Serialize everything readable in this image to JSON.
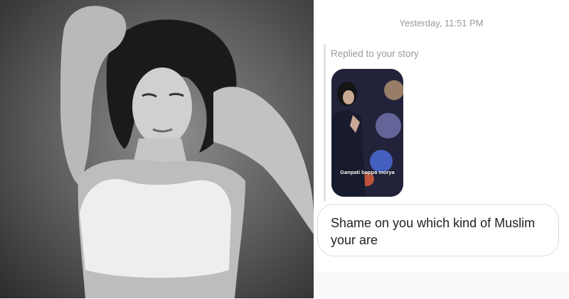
{
  "chat": {
    "timestamp": "Yesterday, 11:51 PM",
    "reply_label": "Replied to your story",
    "story": {
      "caption": "Ganpati bappa morya"
    },
    "message": "Shame on you which kind of Muslim your are"
  },
  "colors": {
    "timestamp_text": "#9a9a9a",
    "bubble_border": "#dcdcdc",
    "message_text": "#222222"
  }
}
